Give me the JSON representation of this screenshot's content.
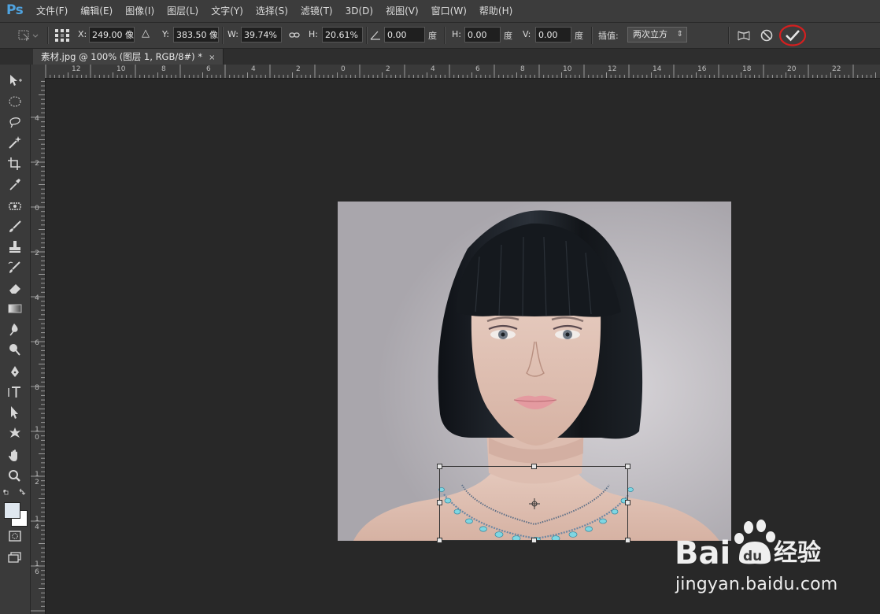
{
  "app": {
    "logo": "Ps"
  },
  "menu": [
    "文件(F)",
    "编辑(E)",
    "图像(I)",
    "图层(L)",
    "文字(Y)",
    "选择(S)",
    "滤镜(T)",
    "3D(D)",
    "视图(V)",
    "窗口(W)",
    "帮助(H)"
  ],
  "options": {
    "x_label": "X:",
    "x_value": "249.00 像",
    "y_label": "Y:",
    "y_value": "383.50 像",
    "w_label": "W:",
    "w_value": "39.74%",
    "h_label": "H:",
    "h_value": "20.61%",
    "angle_value": "0.00",
    "angle_unit": "度",
    "hskew_label": "H:",
    "hskew_value": "0.00",
    "hskew_unit": "度",
    "vskew_label": "V:",
    "vskew_value": "0.00",
    "vskew_unit": "度",
    "interp_label": "插值:",
    "interp_value": "两次立方"
  },
  "document_tab": {
    "title": "素材.jpg @ 100% (图层 1, RGB/8#) *",
    "close": "×"
  },
  "ruler_top": [
    "12",
    "10",
    "8",
    "6",
    "4",
    "2",
    "0",
    "2",
    "4",
    "6",
    "8",
    "10",
    "12",
    "14",
    "16",
    "18",
    "20",
    "22"
  ],
  "ruler_left": [
    "4",
    "2",
    "0",
    "2",
    "4",
    "6",
    "8",
    "10",
    "12",
    "14",
    "16"
  ],
  "watermark": {
    "brand_bai": "Bai",
    "brand_du": "du",
    "brand_cn": "经验",
    "url": "jingyan.baidu.com"
  },
  "colors": {
    "accent_blue": "#4fa3e0",
    "highlight_circle": "#d41f1f"
  }
}
